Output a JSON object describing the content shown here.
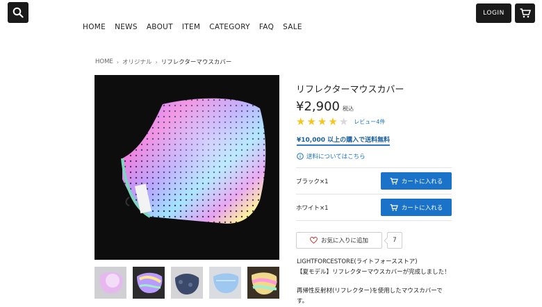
{
  "header": {
    "login_label": "LOGIN",
    "nav": [
      "HOME",
      "NEWS",
      "ABOUT",
      "ITEM",
      "CATEGORY",
      "FAQ",
      "SALE"
    ]
  },
  "breadcrumb": {
    "home": "HOME",
    "category": "オリジナル",
    "current": "リフレクターマウスカバー"
  },
  "product": {
    "title": "リフレクターマウスカバー",
    "price": "¥2,900",
    "tax_label": "税込",
    "rating": 4,
    "rating_max": 5,
    "review_label": "レビュー4件",
    "free_shipping": "¥10,000 以上の購入で送料無料",
    "shipping_info": "送料についてはこちら",
    "variants": [
      {
        "label": "ブラック×1",
        "button": "カートに入れる"
      },
      {
        "label": "ホワイト×1",
        "button": "カートに入れる"
      }
    ],
    "favorite_label": "お気に入りに追加",
    "favorite_count": "7",
    "description": [
      "LIGHTFORCESTORE(ライトフォースストア)",
      "【夏モデル】リフレクターマウスカバーが完成しました！",
      "",
      "再帰性反射材(リフレクター)を使用したマウスカバーで",
      "す。"
    ]
  },
  "colors": {
    "accent": "#1a73c8",
    "dark": "#1a1a1a",
    "star": "#f5c518"
  }
}
